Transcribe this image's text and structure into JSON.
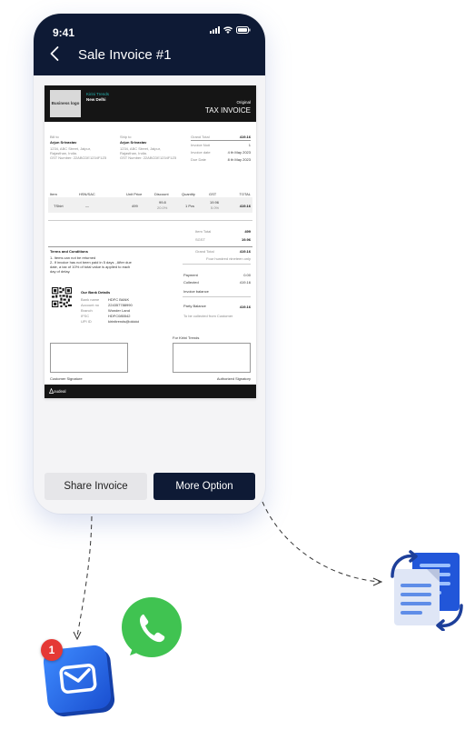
{
  "status_bar": {
    "time": "9:41"
  },
  "header": {
    "title": "Sale Invoice #1"
  },
  "invoice": {
    "logo_text": "Business logo",
    "company": "Kirini Trends",
    "city": "New Delhi",
    "copy_type": "Original",
    "doc_title": "TAX INVOICE",
    "bill_to": {
      "label": "Bill to",
      "name": "Arjun Srivastav",
      "address1": "1234, ABC Street, Jaipur,",
      "address2": "Rajasthan, India.",
      "gst": "GST Number: 22ABCDE1234F1Z5"
    },
    "ship_to": {
      "label": "Ship to",
      "name": "Arjun Srivastav",
      "address1": "1234, ABC Street, Jaipur,",
      "address2": "Rajasthan, India.",
      "gst": "GST Number: 22ABCDE1234F1Z5"
    },
    "meta": [
      {
        "label": "Grand Total",
        "value": "419.16"
      },
      {
        "label": "Invoice No#",
        "value": "1"
      },
      {
        "label": "Invoice date",
        "value": "4 th May 2023"
      },
      {
        "label": "Due Date",
        "value": "8 th May 2023"
      }
    ],
    "columns": [
      "Item",
      "HSN/SAC",
      "Unit Price",
      "Discount",
      "Quantity",
      "GST",
      "TOTAL"
    ],
    "row": {
      "item": "TShirt",
      "hsn": "—",
      "unit_price": "499",
      "discount": "99.8",
      "discount_pct": "20.0%",
      "quantity": "1 Pcs",
      "gst": "19.96",
      "gst_pct": "5.0%",
      "total": "419.16"
    },
    "item_total": {
      "label": "Item Total",
      "value": "499"
    },
    "sgst": {
      "label": "SGST",
      "value": "19.96"
    },
    "grand_total": {
      "label": "Grand Total",
      "value": "419.16"
    },
    "amount_words": "Four hundred nineteen only",
    "terms_title": "Terms and Conditions",
    "terms": [
      "1- Items can not be returned",
      "2- If invoice has not been paid in 5 days , After due",
      "date, a tax of 10% of total value is applied to each",
      "day of delay."
    ],
    "payment": {
      "label": "Payment",
      "value": "0.00"
    },
    "collected": {
      "label": "Collected",
      "value": "419.16"
    },
    "invoice_balance": "Invoice balance",
    "party_balance": {
      "label": "Party Balance",
      "value": "419.16"
    },
    "to_collect": "To be collected from Customer",
    "bank_title": "Our Bank Details",
    "bank": [
      {
        "label": "Bank name",
        "value": "HDFC BANK"
      },
      {
        "label": "Account no",
        "value": "224357788990"
      },
      {
        "label": "Branch",
        "value": "Wonder Land"
      },
      {
        "label": "IFSC",
        "value": "HDFC085542"
      },
      {
        "label": "UPI ID",
        "value": "kirinitrends@okicici"
      }
    ],
    "for_company": "For Kirini Trends",
    "customer_signature": "Customer Signature",
    "authorized_signatory": "Authorized Signatory",
    "footer_brand": "oudeal"
  },
  "actions": {
    "share": "Share Invoice",
    "more": "More Option"
  },
  "mail_badge": "1",
  "colors": {
    "navy": "#0e1a35",
    "teal": "#25b3b0",
    "whatsapp": "#40c351",
    "mail_blue": "#1f63e6",
    "badge_red": "#e53935"
  }
}
